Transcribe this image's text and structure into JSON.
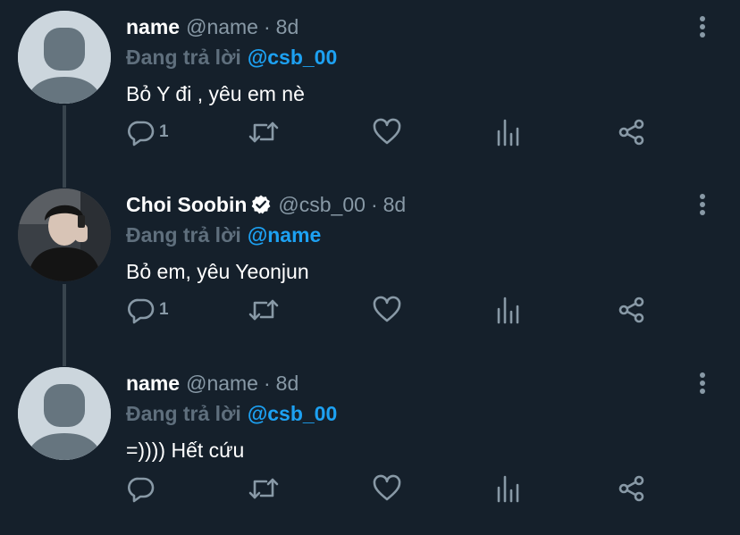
{
  "colors": {
    "background": "#15202b",
    "secondary_text": "#8899a6",
    "mention": "#1da1f2",
    "verified_badge": "#ffffff",
    "thread_line": "#38444d"
  },
  "tweets": [
    {
      "display_name": "name",
      "handle": "@name",
      "separator": "·",
      "time": "8d",
      "reply_prefix": "Đang trả lời",
      "reply_to": "@csb_00",
      "text": "Bỏ Y đi , yêu em nè",
      "reply_count": "1",
      "avatar": "default-avatar-icon",
      "verified": false
    },
    {
      "display_name": "Choi Soobin",
      "handle": "@csb_00",
      "separator": "·",
      "time": "8d",
      "reply_prefix": "Đang trả lời",
      "reply_to": "@name",
      "text": "Bỏ em, yêu Yeonjun",
      "reply_count": "1",
      "avatar": "profile-photo",
      "verified": true
    },
    {
      "display_name": "name",
      "handle": "@name",
      "separator": "·",
      "time": "8d",
      "reply_prefix": "Đang trả lời",
      "reply_to": "@csb_00",
      "text": "=)))) Hết cứu",
      "reply_count": "",
      "avatar": "default-avatar-icon",
      "verified": false
    }
  ],
  "icons": {
    "reply": "reply-bubble-icon",
    "retweet": "retweet-icon",
    "like": "heart-icon",
    "analytics": "analytics-bars-icon",
    "share": "share-icon",
    "more": "more-vertical-icon"
  }
}
